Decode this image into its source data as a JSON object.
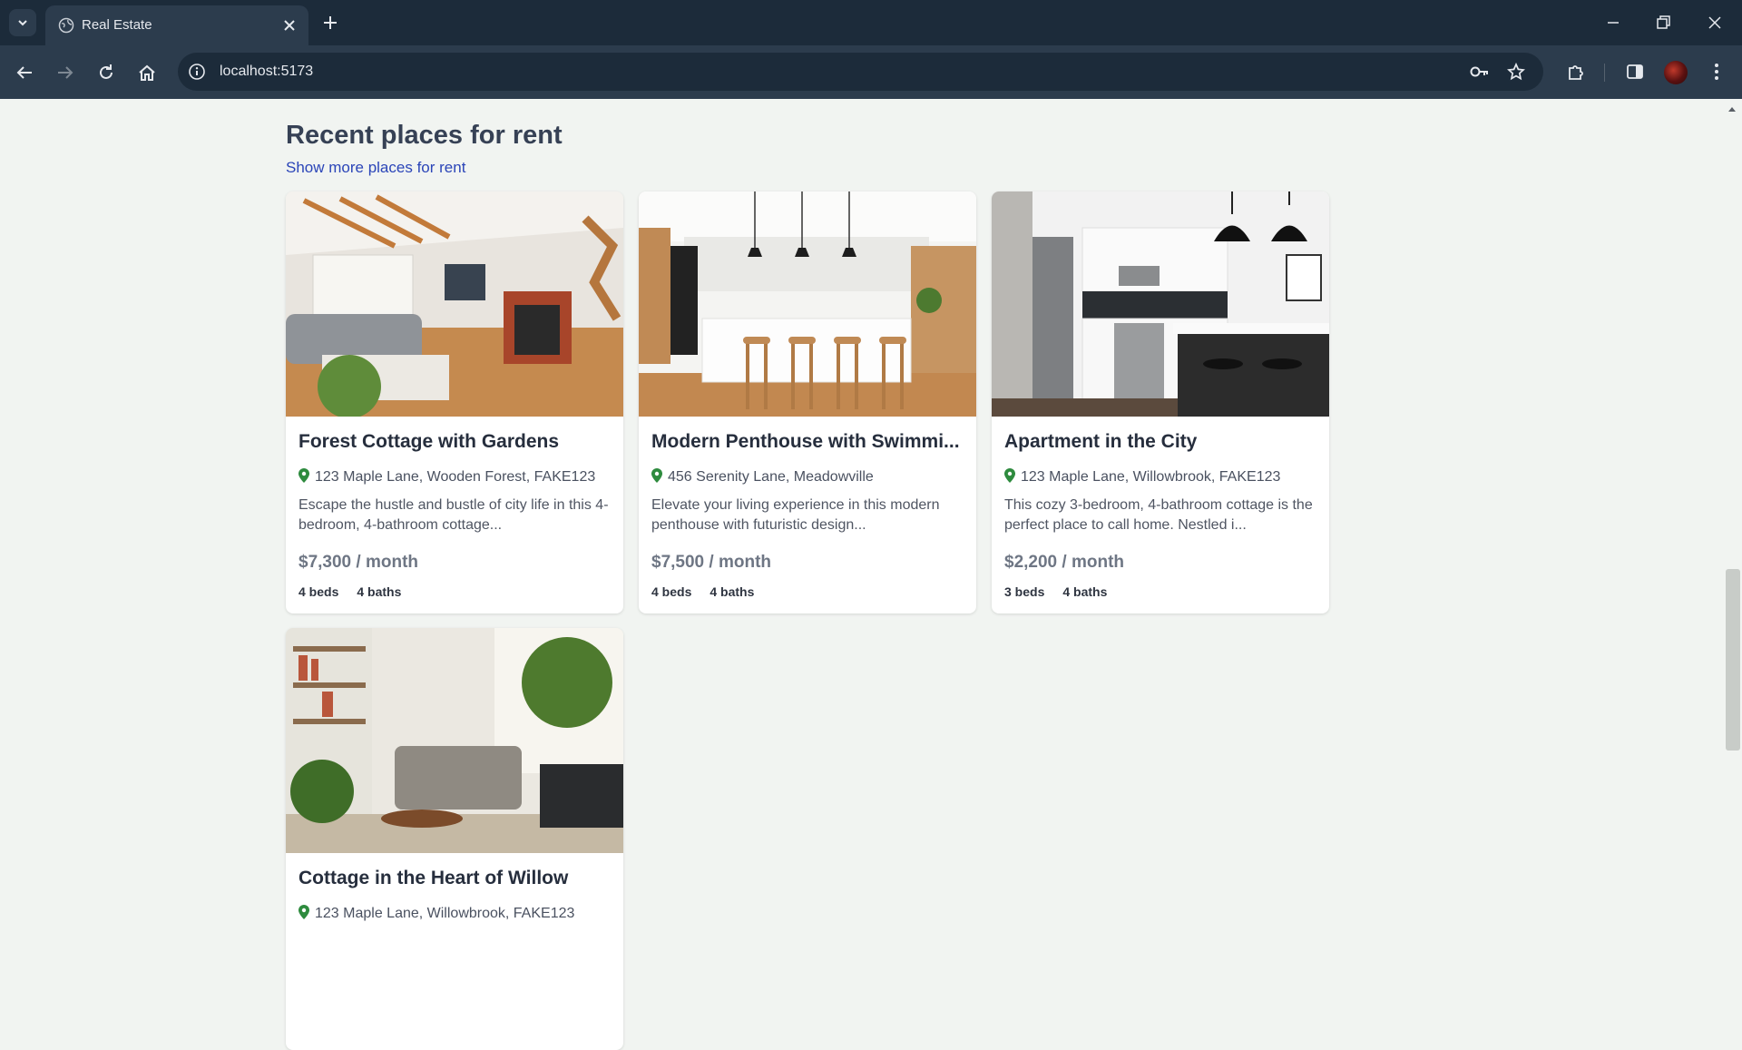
{
  "browser": {
    "tab_title": "Real Estate",
    "url": "localhost:5173"
  },
  "page": {
    "section_title": "Recent places for rent",
    "show_more_label": "Show more places for rent"
  },
  "listings": [
    {
      "title": "Forest Cottage with Gardens",
      "address": "123 Maple Lane, Wooden Forest, FAKE123",
      "description": "Escape the hustle and bustle of city life in this 4-bedroom, 4-bathroom cottage...",
      "price": "$7,300",
      "price_suffix": " / month",
      "beds": "4 beds",
      "baths": "4 baths",
      "photo_icon": "living-room-photo"
    },
    {
      "title": "Modern Penthouse with Swimmi...",
      "address": "456 Serenity Lane, Meadowville",
      "description": "Elevate your living experience in this modern penthouse with futuristic design...",
      "price": "$7,500",
      "price_suffix": " / month",
      "beds": "4 beds",
      "baths": "4 baths",
      "photo_icon": "kitchen-island-photo"
    },
    {
      "title": "Apartment in the City",
      "address": "123 Maple Lane, Willowbrook, FAKE123",
      "description": "This cozy 3-bedroom, 4-bathroom cottage is the perfect place to call home. Nestled i...",
      "price": "$2,200",
      "price_suffix": " / month",
      "beds": "3 beds",
      "baths": "4 baths",
      "photo_icon": "kitchen-photo"
    },
    {
      "title": "Cottage in the Heart of Willow",
      "address": "123 Maple Lane, Willowbrook, FAKE123",
      "photo_icon": "plant-living-room-photo"
    }
  ],
  "colors": {
    "page_background": "#f1f4f1",
    "link": "#2b45b8",
    "pin": "#2e8b3e",
    "tabstrip": "#1c2b3a",
    "toolbar": "#2c3c4d"
  }
}
